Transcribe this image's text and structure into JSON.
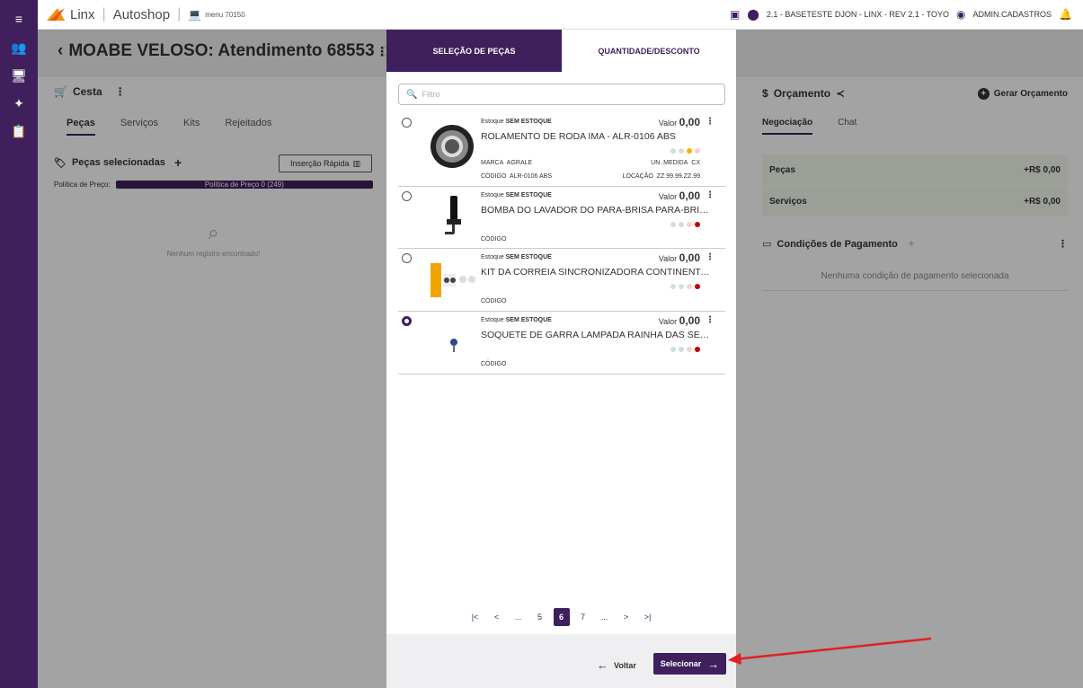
{
  "topbar": {
    "brand": "Linx",
    "app": "Autoshop",
    "menu": "menu 70150",
    "location": "2.1 - BASETESTE DJON - LINX - REV 2.1 - TOYO",
    "user": "ADMIN.CADASTROS"
  },
  "page": {
    "title": "MOABE VELOSO: Atendimento 68553"
  },
  "left": {
    "cesta": "Cesta",
    "tabs": [
      "Peças",
      "Serviços",
      "Kits",
      "Rejeitados"
    ],
    "pecas_selecionadas": "Peças selecionadas",
    "insercao": "Inserção Rápida",
    "politica_label": "Política de Preço:",
    "politica_value": "Política de Preço 0 (249)",
    "empty": "Nenhum registro encontrado!"
  },
  "right": {
    "orcamento": "Orçamento",
    "gerar": "Gerar Orçamento",
    "tabs": [
      "Negociação",
      "Chat"
    ],
    "pecas_label": "Peças",
    "pecas_value": "+R$ 0,00",
    "servicos_label": "Serviços",
    "servicos_value": "+R$ 0,00",
    "condicoes": "Condições de Pagamento",
    "condicoes_empty": "Nenhuma condição de pagamento selecionada"
  },
  "modal": {
    "step1": "SELEÇÃO DE PEÇAS",
    "step2": "QUANTIDADE/DESCONTO",
    "filter_placeholder": "Filtro",
    "items": [
      {
        "stock_label": "Estoque",
        "stock": "SEM ESTOQUE",
        "valor_label": "Valor",
        "valor": "0,00",
        "name": "ROLAMENTO DE RODA IMA - ALR-0106 ABS",
        "marca_label": "MARCA",
        "marca": "AGRALE",
        "un_label": "UN. MEDIDA",
        "un": "CX",
        "codigo_label": "CÓDIGO",
        "codigo": "ALR-0106 ABS",
        "loc_label": "LOCAÇÃO",
        "loc": "ZZ.99.99.ZZ.99",
        "selected": false
      },
      {
        "stock_label": "Estoque",
        "stock": "SEM ESTOQUE",
        "valor_label": "Valor",
        "valor": "0,00",
        "name": "BOMBA DO LAVADOR DO PARA-BRISA PARA-BRISA...",
        "codigo_label": "CÓDIGO",
        "selected": false
      },
      {
        "stock_label": "Estoque",
        "stock": "SEM ESTOQUE",
        "valor_label": "Valor",
        "valor": "0,00",
        "name": "KIT DA CORREIA SINCRONIZADORA CONTINENTAL...",
        "codigo_label": "CÓDIGO",
        "selected": false
      },
      {
        "stock_label": "Estoque",
        "stock": "SEM ESTOQUE",
        "valor_label": "Valor",
        "valor": "0,00",
        "name": "SOQUETE DE GARRA LAMPADA RAINHA DAS SETE ...",
        "codigo_label": "CÓDIGO",
        "selected": true
      }
    ],
    "pager": [
      "|<",
      "<",
      "...",
      "5",
      "6",
      "7",
      "...",
      ">",
      ">|"
    ],
    "current_page": "6",
    "voltar": "Voltar",
    "selecionar": "Selecionar"
  },
  "colors": {
    "primary": "#3f1f5c",
    "accent_orange": "#f39200",
    "annotation_arrow": "#e02020"
  }
}
